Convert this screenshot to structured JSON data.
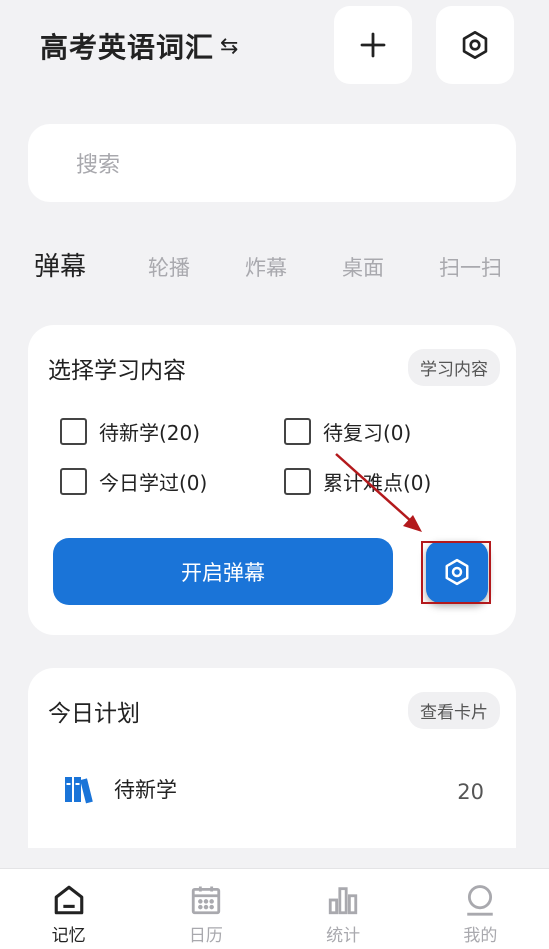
{
  "header": {
    "title": "高考英语词汇",
    "swap_glyph": "⇆"
  },
  "search": {
    "placeholder": "搜索"
  },
  "tabs": [
    {
      "label": "弹幕",
      "active": true
    },
    {
      "label": "轮播",
      "active": false
    },
    {
      "label": "炸幕",
      "active": false
    },
    {
      "label": "桌面",
      "active": false
    },
    {
      "label": "扫一扫",
      "active": false
    }
  ],
  "study_card": {
    "title": "选择学习内容",
    "chip": "学习内容",
    "options": [
      {
        "label": "待新学(20)"
      },
      {
        "label": "待复习(0)"
      },
      {
        "label": "今日学过(0)"
      },
      {
        "label": "累计难点(0)"
      }
    ],
    "start_button": "开启弹幕"
  },
  "plan_card": {
    "title": "今日计划",
    "chip": "查看卡片",
    "item_label": "待新学",
    "item_count": "20"
  },
  "bottom_nav": [
    {
      "label": "记忆",
      "icon": "home-icon",
      "active": true
    },
    {
      "label": "日历",
      "icon": "calendar-icon",
      "active": false
    },
    {
      "label": "统计",
      "icon": "bar-chart-icon",
      "active": false
    },
    {
      "label": "我的",
      "icon": "profile-icon",
      "active": false
    }
  ],
  "colors": {
    "accent": "#1a74d8",
    "highlight": "#b3191c"
  }
}
